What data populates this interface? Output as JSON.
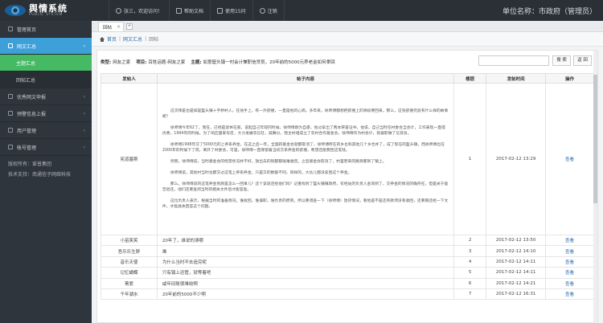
{
  "header": {
    "logo_cn": "舆情系统",
    "logo_en": "PUBLIC SYSTEM",
    "menu": [
      "张三，欢迎访问！",
      "帮助文档",
      "使用15问",
      "注销"
    ],
    "unit": "单位名称：市政府（管理员）"
  },
  "sidebar": {
    "items": [
      {
        "label": "管理首页",
        "arrow": ""
      },
      {
        "label": "网文汇总",
        "arrow": "›",
        "active": true
      },
      {
        "label": "主题汇总",
        "sub": true,
        "current": true
      },
      {
        "label": "回帖汇总",
        "sub": true
      },
      {
        "label": "优秀网文申报",
        "arrow": "›"
      },
      {
        "label": "预警信息上报",
        "arrow": "›"
      },
      {
        "label": "用户管理",
        "arrow": "›"
      },
      {
        "label": "帐号管理",
        "arrow": "›"
      }
    ],
    "info_lines": [
      "版权所有：爱普集团",
      "技术支持：南通信子网络科技"
    ]
  },
  "tabs": {
    "active": "回帖",
    "close": "×",
    "add": "+"
  },
  "breadcrumb": [
    "首页",
    "网文汇总",
    "回帖"
  ],
  "topic": {
    "type_label": "类型:",
    "type_value": "网友之家",
    "project_label": "项目:",
    "project_value": "百姓话题-网友之家",
    "subject_label": "主题:",
    "subject_value": "如意窟头镇一村会计兼职信贷员，20年前的5000元养老金如何拿回"
  },
  "search": {
    "placeholder": "",
    "button": "搜 索",
    "back": "返 回"
  },
  "table": {
    "columns": [
      "发帖人",
      "帖子内容",
      "楼层",
      "发帖时间",
      "操作"
    ],
    "first_post": {
      "author": "宪道塞斯",
      "paragraphs": [
        "这次拜是也是如是盔头镇十字桥村人，在他手上，有一外欲撞，一直是他的心病，多年来，徐师傅都想把欲撞上的滑段要回来，那么，这张欲撞究竟有什么样的故事呢？",
        "徐师傅今年62了，我在，已经是退休在家，说起自己年轻的时候，徐师傅颇为自豪，他过拿出了两本荣誉证书，他说，自己当时在村委会当会计，工作表现一直得优秀，1994年的时候，为了响应国家号召，大力发展农信社，鼓舞分，我主村组成立了农村合作基金会，徐师傅作为村会计，就兼职做了信贷员。",
        "徐师傅1998年交了5000元的上养系养金，在这之后一年，全国的基金会就都取消了，徐师傅所在的乡也和其他几个乡合并了，成了现在的盔头镇，而徐师傅也在2000年的时候下了岗，离开了村委会，可是，徐师傅一直保留着当初交系养金的欲撞，希望还能要回这笔钱。",
        "然而，徐师傅说，当时基金会的经营状况并不好，放出去的钱都都很难收回，之后基金会取消了，村里原来的路目都到了镇上。",
        "徐师傅说，其他村当时也都交过这笔上养系养金，只是交的数额不同，同样的，大伙儿都没拿回这个养金。",
        "那么，徐师傅说的这笔养金到底是怎么一回事儿？这个该退还给他们吗？记者找到了盔头镇镇政府，农经站的负责人查询到了，交养金的情况的确存在，但是关于能否退还，他们还要查阅当时的相关文件后才能答复。",
        "这位负责人表示，根据当时的准备情况，谁收回，谁兼职，谁负责的原则，所以要调查一下（徐师傅）放贷情况，看他是不是还有款项没有收回，还要再还给一下文件，才能具体回答这个问题。"
      ],
      "floor": "1",
      "time": "2017-02-12 13:29",
      "action": "查看"
    },
    "rows": [
      {
        "author": "小苗笑笑",
        "content": "20年了，谁说的清哪",
        "floor": "2",
        "time": "2017-02-12 13:50",
        "action": "查看"
      },
      {
        "author": "吾乐乐生舒",
        "content": "难",
        "floor": "3",
        "time": "2017-02-12 14:10",
        "action": "查看"
      },
      {
        "author": "音乐天使",
        "content": "为什么当时不去追究呢",
        "floor": "4",
        "time": "2017-02-12 14:11",
        "action": "查看"
      },
      {
        "author": "记忆蝴蝶",
        "content": "只有镇上还管，就等着吧",
        "floor": "5",
        "time": "2017-02-12 14:11",
        "action": "查看"
      },
      {
        "author": "菁爱",
        "content": "咸年旧账很难收啊",
        "floor": "6",
        "time": "2017-02-12 14:21",
        "action": "查看"
      },
      {
        "author": "千年湖水",
        "content": "20年前的5000不少啊",
        "floor": "7",
        "time": "2017-02-12 16:31",
        "action": "查看"
      }
    ]
  }
}
